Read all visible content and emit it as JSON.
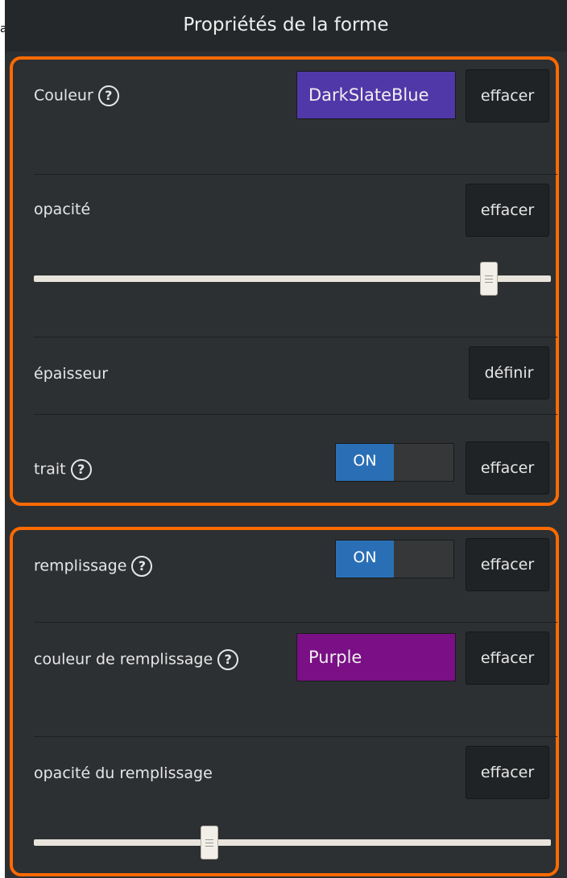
{
  "title": "Propriétés de la forme",
  "clipped_char": "a",
  "stroke_group": {
    "color": {
      "label": "Couleur",
      "value": "DarkSlateBlue",
      "swatch_color": "#5138a8",
      "clear_label": "effacer"
    },
    "opacity": {
      "label": "opacité",
      "clear_label": "effacer",
      "slider_value_fraction": 0.88
    },
    "thickness": {
      "label": "épaisseur",
      "set_label": "définir"
    },
    "stroke": {
      "label": "trait",
      "toggle_label": "ON",
      "clear_label": "effacer"
    }
  },
  "fill_group": {
    "fill": {
      "label": "remplissage",
      "toggle_label": "ON",
      "clear_label": "effacer"
    },
    "fill_color": {
      "label": "couleur de remplissage",
      "value": "Purple",
      "swatch_color": "#7a0f86",
      "clear_label": "effacer"
    },
    "fill_opacity": {
      "label": "opacité du remplissage",
      "clear_label": "effacer",
      "slider_value_fraction": 0.34
    }
  },
  "help_glyph": "?",
  "colors": {
    "accent_border": "#ff6a00",
    "panel_bg": "#2d3033",
    "toggle_on": "#2a6fb5"
  }
}
